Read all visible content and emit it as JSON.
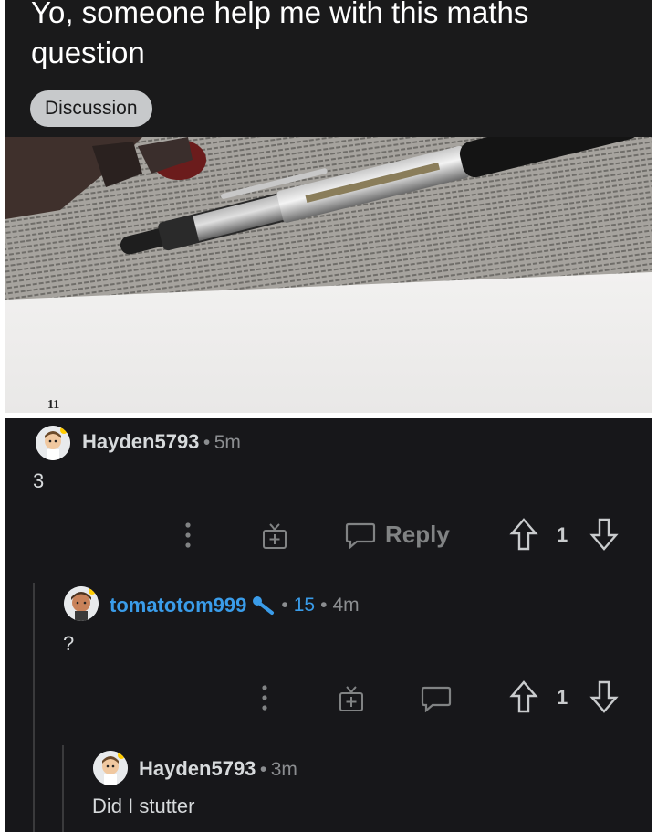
{
  "post": {
    "title": "Yo, someone help me with this maths question",
    "flair": "Discussion",
    "image": {
      "page_number": "11"
    }
  },
  "comments": [
    {
      "username": "Hayden5793",
      "separator": "•",
      "age": "5m",
      "body": "3",
      "reply_label": "Reply",
      "votes": "1"
    },
    {
      "username": "tomatotom999",
      "separator": "•",
      "karma": "15",
      "age": "4m",
      "body": "?",
      "votes": "1"
    },
    {
      "username": "Hayden5793",
      "separator": "•",
      "age": "3m",
      "body": "Did I stutter"
    }
  ]
}
